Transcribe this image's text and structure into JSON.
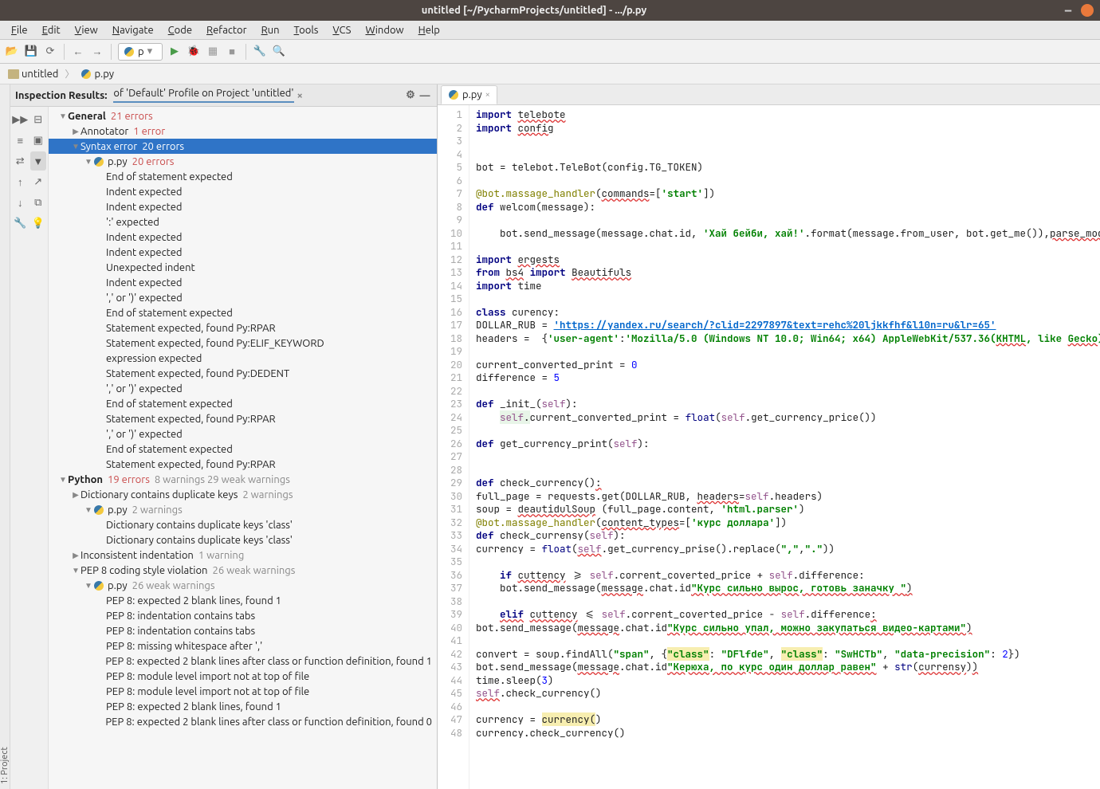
{
  "window": {
    "title": "untitled [~/PycharmProjects/untitled] - .../p.py"
  },
  "menu": [
    "File",
    "Edit",
    "View",
    "Navigate",
    "Code",
    "Refactor",
    "Run",
    "Tools",
    "VCS",
    "Window",
    "Help"
  ],
  "run_config": "p",
  "breadcrumbs": [
    {
      "icon": "folder",
      "label": "untitled"
    },
    {
      "icon": "py",
      "label": "p.py"
    }
  ],
  "side_strip": {
    "project_label": "1: Project"
  },
  "inspection": {
    "header_label": "Inspection Results:",
    "profile_label": "of 'Default' Profile on Project 'untitled'",
    "tree": [
      {
        "depth": 1,
        "caret": "down",
        "bold": true,
        "text": "General",
        "suffix": "21 errors",
        "suffix_class": "errct"
      },
      {
        "depth": 2,
        "caret": "right",
        "text": "Annotator",
        "suffix": "1 error",
        "suffix_class": "errct"
      },
      {
        "depth": 2,
        "caret": "down",
        "text": "Syntax error",
        "suffix": "20 errors",
        "suffix_class": "errct",
        "selected": true
      },
      {
        "depth": 3,
        "caret": "down",
        "icon": "py",
        "text": "p.py",
        "suffix": "20 errors",
        "suffix_class": "errct"
      },
      {
        "depth": 4,
        "text": "End of statement expected"
      },
      {
        "depth": 4,
        "text": "Indent expected"
      },
      {
        "depth": 4,
        "text": "Indent expected"
      },
      {
        "depth": 4,
        "text": "':' expected"
      },
      {
        "depth": 4,
        "text": "Indent expected"
      },
      {
        "depth": 4,
        "text": "Indent expected"
      },
      {
        "depth": 4,
        "text": "Unexpected indent"
      },
      {
        "depth": 4,
        "text": "Indent expected"
      },
      {
        "depth": 4,
        "text": "',' or ')' expected"
      },
      {
        "depth": 4,
        "text": "End of statement expected"
      },
      {
        "depth": 4,
        "text": "Statement expected, found Py:RPAR"
      },
      {
        "depth": 4,
        "text": "Statement expected, found Py:ELIF_KEYWORD"
      },
      {
        "depth": 4,
        "text": "expression expected"
      },
      {
        "depth": 4,
        "text": "Statement expected, found Py:DEDENT"
      },
      {
        "depth": 4,
        "text": "',' or ')' expected"
      },
      {
        "depth": 4,
        "text": "End of statement expected"
      },
      {
        "depth": 4,
        "text": "Statement expected, found Py:RPAR"
      },
      {
        "depth": 4,
        "text": "',' or ')' expected"
      },
      {
        "depth": 4,
        "text": "End of statement expected"
      },
      {
        "depth": 4,
        "text": "Statement expected, found Py:RPAR"
      },
      {
        "depth": 1,
        "caret": "down",
        "bold": true,
        "text": "Python",
        "suffix": "19 errors",
        "suffix_class": "errct",
        "suffix2": "8 warnings 29 weak warnings",
        "suffix2_class": "wct"
      },
      {
        "depth": 2,
        "caret": "right",
        "text": "Dictionary contains duplicate keys",
        "suffix": "2 warnings",
        "suffix_class": "wct"
      },
      {
        "depth": 3,
        "caret": "down",
        "icon": "py",
        "text": "p.py",
        "suffix": "2 warnings",
        "suffix_class": "wct"
      },
      {
        "depth": 4,
        "text": "Dictionary contains duplicate keys 'class'"
      },
      {
        "depth": 4,
        "text": "Dictionary contains duplicate keys 'class'"
      },
      {
        "depth": 2,
        "caret": "right",
        "text": "Inconsistent indentation",
        "suffix": "1 warning",
        "suffix_class": "wct"
      },
      {
        "depth": 2,
        "caret": "down",
        "text": "PEP 8 coding style violation",
        "suffix": "26 weak warnings",
        "suffix_class": "wct"
      },
      {
        "depth": 3,
        "caret": "down",
        "icon": "py",
        "text": "p.py",
        "suffix": "26 weak warnings",
        "suffix_class": "wct"
      },
      {
        "depth": 4,
        "text": "PEP 8: expected 2 blank lines, found 1"
      },
      {
        "depth": 4,
        "text": "PEP 8: indentation contains tabs"
      },
      {
        "depth": 4,
        "text": "PEP 8: indentation contains tabs"
      },
      {
        "depth": 4,
        "text": "PEP 8: missing whitespace after ','"
      },
      {
        "depth": 4,
        "text": "PEP 8: expected 2 blank lines after class or function definition, found 1"
      },
      {
        "depth": 4,
        "text": "PEP 8: module level import not at top of file"
      },
      {
        "depth": 4,
        "text": "PEP 8: module level import not at top of file"
      },
      {
        "depth": 4,
        "text": "PEP 8: expected 2 blank lines, found 1"
      },
      {
        "depth": 4,
        "text": "PEP 8: expected 2 blank lines after class or function definition, found 0"
      }
    ]
  },
  "editor": {
    "tab_label": "p.py",
    "lines": [
      {
        "n": 1,
        "html": "<span class='kw'>import</span> <span class='err'>telebote</span>"
      },
      {
        "n": 2,
        "html": "<span class='kw'>import</span> <span class='err'>config</span>"
      },
      {
        "n": 3,
        "html": ""
      },
      {
        "n": 4,
        "html": ""
      },
      {
        "n": 5,
        "html": "bot = telebot.TeleBot(config.TG_TOKEN)"
      },
      {
        "n": 6,
        "html": ""
      },
      {
        "n": 7,
        "html": "<span class='dec'>@bot.massage_handler</span>(<span class='err'>commands</span>=[<span class='str'>'start'</span>])"
      },
      {
        "n": 8,
        "html": "<span class='kw'>def</span> welcom(message):"
      },
      {
        "n": 9,
        "html": ""
      },
      {
        "n": 10,
        "html": "    bot.send_message(message.chat.id, <span class='str'>'Хай бейби, хай!'</span>.format(message.from_user, bot.get_me()),<span class='err'>parse_mod</span>"
      },
      {
        "n": 11,
        "html": ""
      },
      {
        "n": 12,
        "html": "<span class='kw'>import</span> <span class='err'>ergests</span>"
      },
      {
        "n": 13,
        "html": "<span class='kw'>from</span> <span class='err'>bs4</span> <span class='kw'>import</span> <span class='err'>Beautifuls</span>"
      },
      {
        "n": 14,
        "html": "<span class='kw'>import</span> time"
      },
      {
        "n": 15,
        "html": ""
      },
      {
        "n": 16,
        "html": "<span class='kw'>class</span> curency:"
      },
      {
        "n": 17,
        "html": "DOLLAR_RUB = <span class='url'>'https://yandex.ru/search/?clid=2297897&text=rehc%20ljkkfhf&l10n=ru&lr=65'</span>"
      },
      {
        "n": 18,
        "html": "headers =  {<span class='str'>'user-agent'</span>:<span class='str'>'Mozilla/5.0 (Windows NT 10.0; Win64; x64) AppleWebKit/537.36(<span class=\"err\">KHTML</span>, like <span class=\"err\">Gecko</span>)'</span>"
      },
      {
        "n": 19,
        "html": ""
      },
      {
        "n": 20,
        "html": "current_converted_print = <span class='num'>0</span>"
      },
      {
        "n": 21,
        "html": "difference = <span class='num'>5</span>"
      },
      {
        "n": 22,
        "html": ""
      },
      {
        "n": 23,
        "html": "<span class='kw'>def</span> _init_(<span class='self'>self</span>):"
      },
      {
        "n": 24,
        "html": "    <span class='bg-g'><span class='self'>self</span>.</span>current_converted_print = <span class='bi'>float</span>(<span class='self'>self</span>.get_currency_price())"
      },
      {
        "n": 25,
        "html": ""
      },
      {
        "n": 26,
        "html": "<span class='kw'>def</span> get_currency_print(<span class='self'>self</span>):"
      },
      {
        "n": 27,
        "html": ""
      },
      {
        "n": 28,
        "html": ""
      },
      {
        "n": 29,
        "html": "<span class='kw'>def</span> check_currency()<span class='err'>:</span>"
      },
      {
        "n": 30,
        "html": "full_page = requests.get(DOLLAR_RUB, <span class='err'>headers</span>=<span class='self'>self</span>.headers)"
      },
      {
        "n": 31,
        "html": "soup = <span class='err'>deautidulSoup</span> (full_page.content, <span class='str'>'html.parser'</span>)"
      },
      {
        "n": 32,
        "html": "<span class='dec'>@bot.massage_handler</span>(<span class='err'>content_types</span>=[<span class='str'>'курс доллара'</span>])"
      },
      {
        "n": 33,
        "html": "<span class='kw'>def</span> check_currensy(<span class='self'>self</span>):"
      },
      {
        "n": 34,
        "html": "currency = <span class='bi'>float</span>(<span class='self err'>self</span>.get_currency_prise().replace(<span class='str'>\",\"</span>,<span class='str'>\".\"</span>))"
      },
      {
        "n": 35,
        "html": ""
      },
      {
        "n": 36,
        "html": "    <span class='kw'>if</span> <span class='err'>cuttency</span> &gt;= <span class='self'>self</span>.corrent_coverted_price + <span class='self'>self</span>.difference:"
      },
      {
        "n": 37,
        "html": "    bot.send_message(<span class='err'>message</span>.chat.id<span class='str err'>\"Курс сильно вырос, готовь заначку \"</span><span class='err'>)</span>"
      },
      {
        "n": 38,
        "html": ""
      },
      {
        "n": 39,
        "html": "    <span class='kw err'>elif</span> <span class='err'>cuttency</span> &lt;= <span class='self'>self</span>.corrent_coverted_price - <span class='self'>self</span>.difference<span class='err'>:</span>"
      },
      {
        "n": 40,
        "html": "bot.send_message(<span class='err'>message</span>.chat.id<span class='str err'>\"Курс сильно упал, можно закупаться видео-картами\"</span><span class='err'>)</span>"
      },
      {
        "n": 41,
        "html": ""
      },
      {
        "n": 42,
        "html": "convert = soup.findAll(<span class='str'>\"span\"</span>, {<span class='str bg-y'>\"class\"</span>: <span class='str'>\"DFlfde\"</span>, <span class='str bg-y'>\"class\"</span>: <span class='str'>\"SwHCTb\"</span>, <span class='str'>\"data-precision\"</span>: <span class='num'>2</span>})"
      },
      {
        "n": 43,
        "html": "bot.send_message(<span class='err'>message</span>.chat.id<span class='str err'>\"Керюха, по курс один доллар равен\"</span> + <span class='bi'>str</span>(<span class='err'>currensy</span>)<span class='err'>)</span>"
      },
      {
        "n": 44,
        "html": "time.sleep(<span class='num'>3</span>)"
      },
      {
        "n": 45,
        "html": "<span class='self err'>self</span>.check_currency()"
      },
      {
        "n": 46,
        "html": ""
      },
      {
        "n": 47,
        "html": "currency = <span class='bg-y'>currency(</span>)"
      },
      {
        "n": 48,
        "html": "currency.check_currency()"
      }
    ]
  }
}
